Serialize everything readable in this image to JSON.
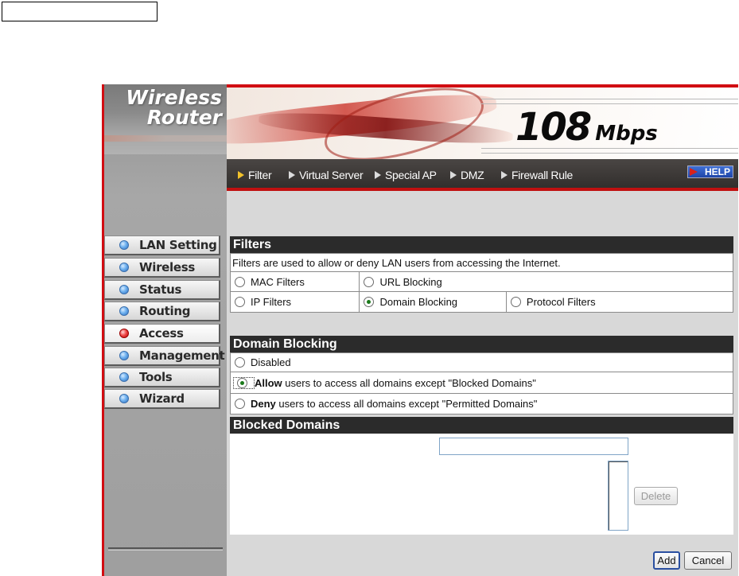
{
  "sidebar": {
    "logo_line1": "Wireless",
    "logo_line2": "Router",
    "items": [
      {
        "label": "LAN Setting"
      },
      {
        "label": "Wireless"
      },
      {
        "label": "Status"
      },
      {
        "label": "Routing"
      },
      {
        "label": "Access",
        "active": true
      },
      {
        "label": "Management"
      },
      {
        "label": "Tools"
      },
      {
        "label": "Wizard"
      }
    ]
  },
  "banner": {
    "speed_big": "108",
    "speed_unit": "Mbps"
  },
  "subnav": {
    "items": [
      {
        "label": "Filter",
        "active": true
      },
      {
        "label": "Virtual Server"
      },
      {
        "label": "Special AP"
      },
      {
        "label": "DMZ"
      },
      {
        "label": "Firewall Rule"
      }
    ],
    "help": "HELP"
  },
  "filters": {
    "title": "Filters",
    "description": "Filters are used to allow or deny LAN users from accessing the Internet.",
    "options": {
      "mac": "MAC Filters",
      "url": "URL Blocking",
      "ip": "IP Filters",
      "domain": "Domain Blocking",
      "protocol": "Protocol Filters"
    },
    "selected": "Domain Blocking"
  },
  "domain_blocking": {
    "title": "Domain Blocking",
    "disabled": "Disabled",
    "allow_bold": "Allow",
    "allow_rest": " users to access all domains except \"Blocked Domains\"",
    "deny_bold": "Deny",
    "deny_rest": " users to access all domains except \"Permitted Domains\"",
    "selected": "Allow"
  },
  "blocked_domains": {
    "title": "Blocked Domains",
    "input_value": "",
    "delete_label": "Delete"
  },
  "actions": {
    "add": "Add",
    "cancel": "Cancel"
  }
}
